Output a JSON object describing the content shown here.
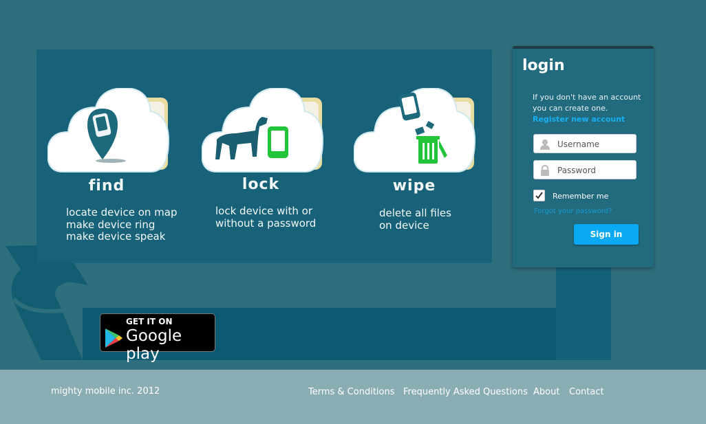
{
  "features": [
    {
      "title": "find",
      "lines": [
        "locate device on map",
        "make device ring",
        "make device speak"
      ]
    },
    {
      "title": "lock",
      "lines": [
        "lock device with or",
        "without a password"
      ]
    },
    {
      "title": "wipe",
      "lines": [
        "delete all files",
        "on device"
      ]
    }
  ],
  "login": {
    "title": "login",
    "info_line1": "If you don't have an account",
    "info_line2": "you can create one.",
    "register_link": "Register new account",
    "username_placeholder": "Username",
    "password_placeholder": "Password",
    "remember_label": "Remember me",
    "forgot_link": "Forgot your password?",
    "signin_label": "Sign in"
  },
  "store_badge": {
    "line1": "GET IT ON",
    "line2": "Google play"
  },
  "footer": {
    "copyright": "mighty mobile inc. 2012",
    "links": [
      "Terms & Conditions",
      "Frequently Asked Questions",
      "About",
      "Contact"
    ]
  },
  "colors": {
    "accent": "#09a9f3",
    "panel": "#176278",
    "background": "#2f6e7d",
    "footer": "#8aadb3"
  }
}
